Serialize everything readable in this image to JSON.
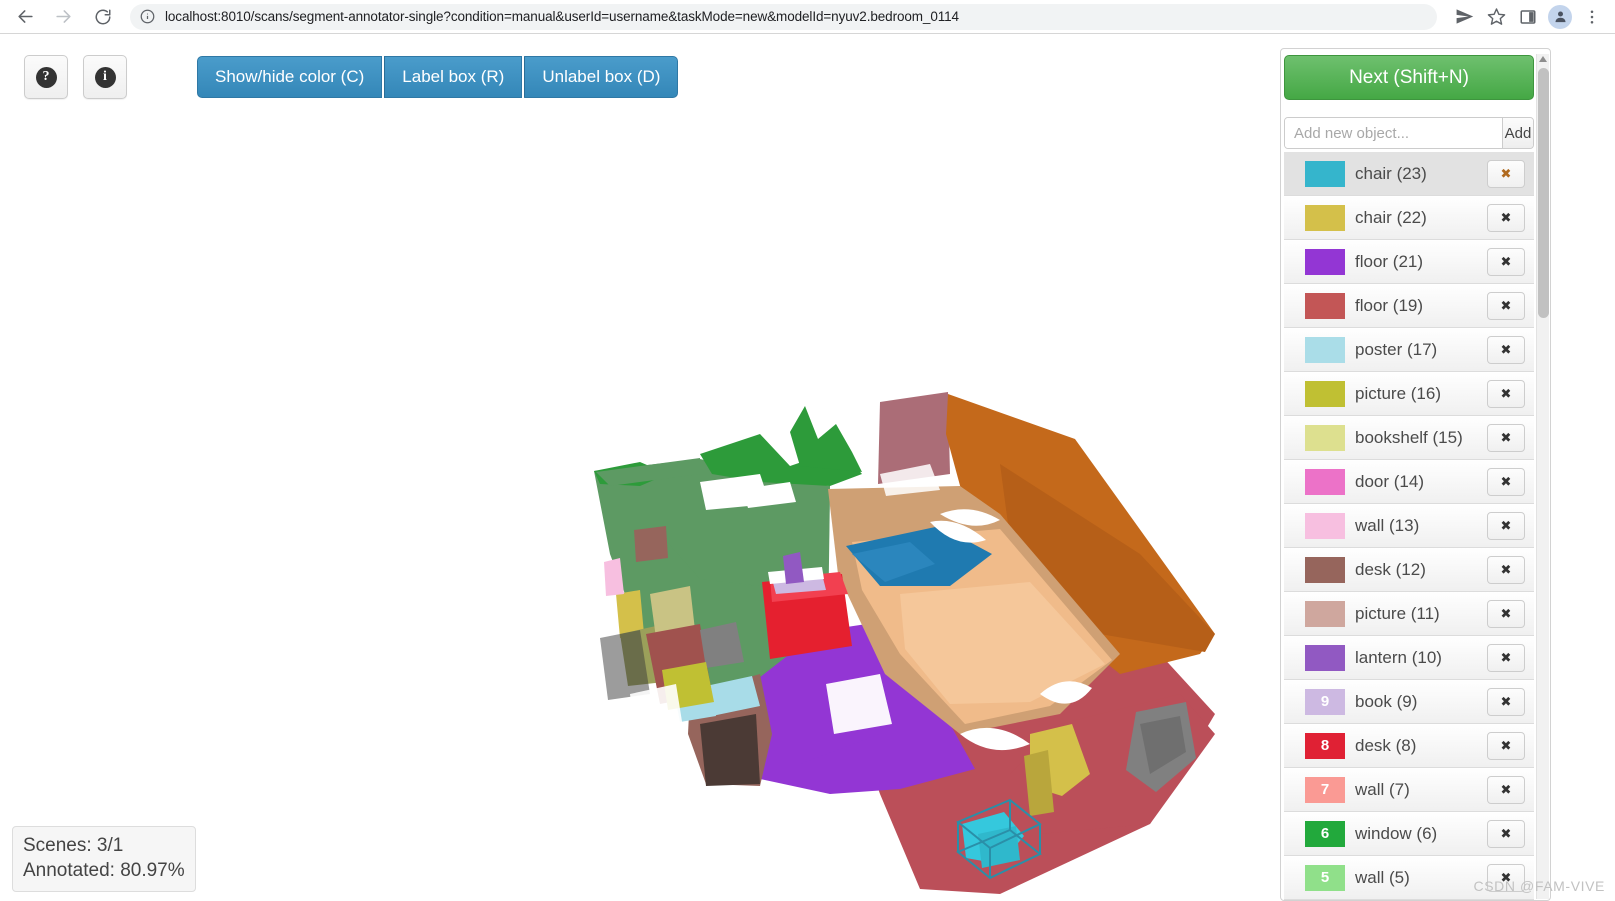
{
  "browser": {
    "back_icon": "back-arrow-icon",
    "forward_icon": "forward-arrow-icon",
    "reload_icon": "reload-icon",
    "site_info_icon": "site-info-icon",
    "url": "localhost:8010/scans/segment-annotator-single?condition=manual&userId=username&taskMode=new&modelId=nyuv2.bedroom_0114",
    "actions": [
      {
        "name": "share-icon",
        "glyph": "send"
      },
      {
        "name": "bookmark-star-icon",
        "glyph": "star"
      },
      {
        "name": "side-panel-icon",
        "glyph": "panel"
      },
      {
        "name": "profile-avatar",
        "glyph": "person"
      },
      {
        "name": "browser-menu-icon",
        "glyph": "kebab"
      }
    ]
  },
  "toolbar": {
    "help_glyph": "?",
    "info_glyph": "i",
    "buttons": [
      {
        "label": "Show/hide color (C)"
      },
      {
        "label": "Label box (R)"
      },
      {
        "label": "Unlabel box (D)"
      }
    ]
  },
  "status": {
    "scenes_label": "Scenes: 3/1",
    "annotated_label": "Annotated: 80.97%"
  },
  "watermark": "CSDN @FAM-VIVE",
  "panel": {
    "next_label": "Next (Shift+N)",
    "add_placeholder": "Add new object...",
    "add_value": "",
    "add_button_label": "Add",
    "delete_glyph": "✖",
    "objects": [
      {
        "label": "chair (23)",
        "color": "#35b5cc",
        "key": "",
        "selected": true
      },
      {
        "label": "chair (22)",
        "color": "#d4c04a",
        "key": "",
        "selected": false
      },
      {
        "label": "floor (21)",
        "color": "#9336d4",
        "key": "",
        "selected": false
      },
      {
        "label": "floor (19)",
        "color": "#c35656",
        "key": "",
        "selected": false
      },
      {
        "label": "poster (17)",
        "color": "#aadde8",
        "key": "",
        "selected": false
      },
      {
        "label": "picture (16)",
        "color": "#c0c033",
        "key": "",
        "selected": false
      },
      {
        "label": "bookshelf (15)",
        "color": "#dde08f",
        "key": "",
        "selected": false
      },
      {
        "label": "door (14)",
        "color": "#ec72c8",
        "key": "",
        "selected": false
      },
      {
        "label": "wall (13)",
        "color": "#f7bfe0",
        "key": "",
        "selected": false
      },
      {
        "label": "desk (12)",
        "color": "#96655c",
        "key": "",
        "selected": false
      },
      {
        "label": "picture (11)",
        "color": "#cfa79e",
        "key": "",
        "selected": false
      },
      {
        "label": "lantern (10)",
        "color": "#9159c2",
        "key": "",
        "selected": false
      },
      {
        "label": "book (9)",
        "color": "#cdb9e2",
        "key": "9",
        "selected": false
      },
      {
        "label": "desk (8)",
        "color": "#e02134",
        "key": "8",
        "selected": false
      },
      {
        "label": "wall (7)",
        "color": "#fa9a94",
        "key": "7",
        "selected": false
      },
      {
        "label": "window (6)",
        "color": "#22a93c",
        "key": "6",
        "selected": false
      },
      {
        "label": "wall (5)",
        "color": "#90e08a",
        "key": "5",
        "selected": false
      }
    ]
  },
  "scene": {
    "name": "nyuv2.bedroom_0114",
    "selection_box_color": "#2a8fa8",
    "segment_colors": {
      "wall_green": "#5d9a63",
      "wall_green_bright": "#2d9b3a",
      "wall_orange": "#c4691b",
      "wall_rose": "#ab6d77",
      "floor_purple": "#9336d4",
      "floor_red": "#bb4f59",
      "bed_tan": "#f0bb8a",
      "bed_frame": "#cfa074",
      "pillow_blue": "#1f7ab0",
      "nightstand_red": "#e5202f",
      "chair_yellow": "#d4c04a",
      "chair_cyan": "#35c8dd",
      "desk_brown": "#96655c",
      "poster_blue": "#a8dce8",
      "gray_object": "#808080",
      "bookshelf_khaki": "#c9c384"
    }
  }
}
